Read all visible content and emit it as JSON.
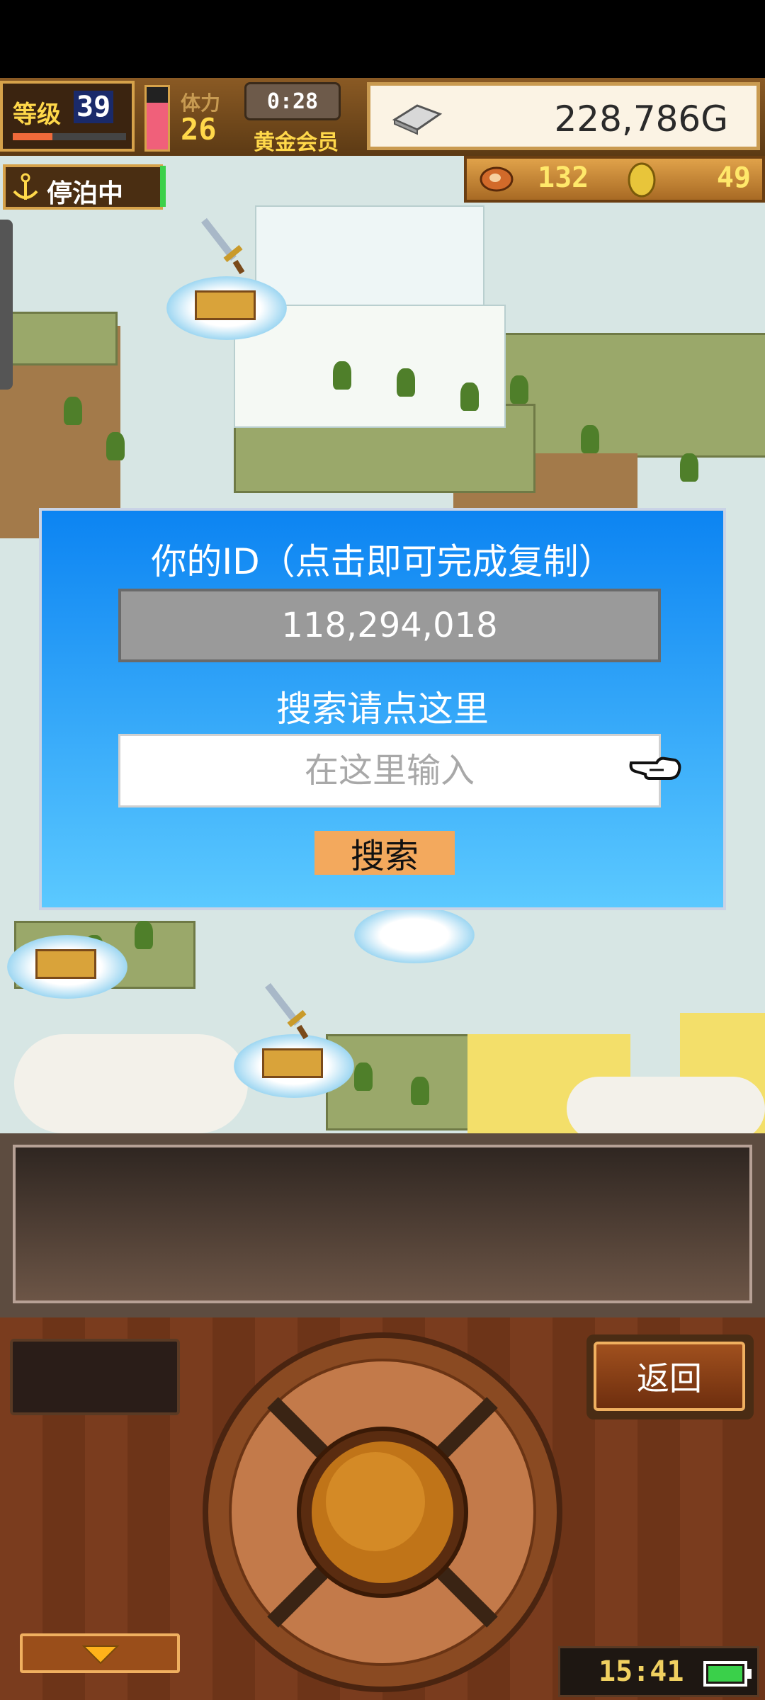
{
  "hud": {
    "level_label": "等级",
    "level_value": "39",
    "stamina_label": "体力",
    "stamina_value": "26",
    "timer": "0:28",
    "membership_badge": "黄金会员",
    "gold": "228,786G",
    "dock_status": "停泊中",
    "food_count": "132",
    "medal_count": "49"
  },
  "dialog": {
    "id_title": "你的ID（点击即可完成复制）",
    "id_value": "118,294,018",
    "search_title": "搜索请点这里",
    "search_placeholder": "在这里输入",
    "search_button": "搜索"
  },
  "controls": {
    "back_button": "返回",
    "clock": "15:41"
  },
  "icons": {
    "anchor": "anchor-icon",
    "gold": "gold-bar-icon",
    "food": "meat-icon",
    "medal": "medal-icon",
    "pointer": "pointing-hand-icon",
    "sword": "sword-icon",
    "battery": "battery-icon"
  },
  "colors": {
    "dialog_top": "#0c84f2",
    "dialog_bottom": "#5bc9ff",
    "search_button": "#f3a95d",
    "hud_text_yellow": "#ffd84a"
  }
}
